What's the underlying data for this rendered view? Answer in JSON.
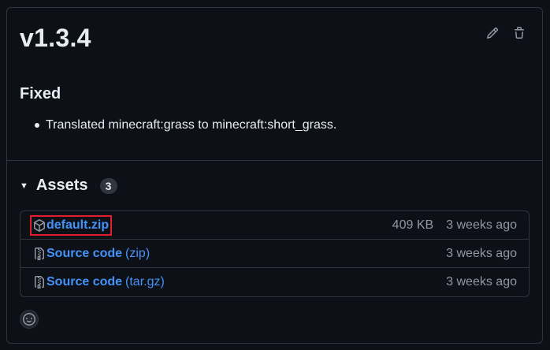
{
  "release": {
    "title": "v1.3.4"
  },
  "actions": {
    "edit_icon": "pencil-icon",
    "delete_icon": "trash-icon"
  },
  "notes": {
    "heading": "Fixed",
    "items": [
      "Translated minecraft:grass to minecraft:short_grass."
    ]
  },
  "assets": {
    "label": "Assets",
    "count": "3",
    "items": [
      {
        "name": "default.zip",
        "suffix": "",
        "size": "409 KB",
        "date": "3 weeks ago",
        "icon": "package-icon",
        "highlighted": true
      },
      {
        "name": "Source code",
        "suffix": "(zip)",
        "size": "",
        "date": "3 weeks ago",
        "icon": "file-zip-icon",
        "highlighted": false
      },
      {
        "name": "Source code",
        "suffix": "(tar.gz)",
        "size": "",
        "date": "3 weeks ago",
        "icon": "file-zip-icon",
        "highlighted": false
      }
    ]
  },
  "reactions": {
    "icon": "smiley-icon"
  },
  "colors": {
    "background": "#0d1117",
    "border": "#30363d",
    "link": "#4493f8",
    "muted": "#9198a1",
    "highlight": "#e11d2e"
  }
}
